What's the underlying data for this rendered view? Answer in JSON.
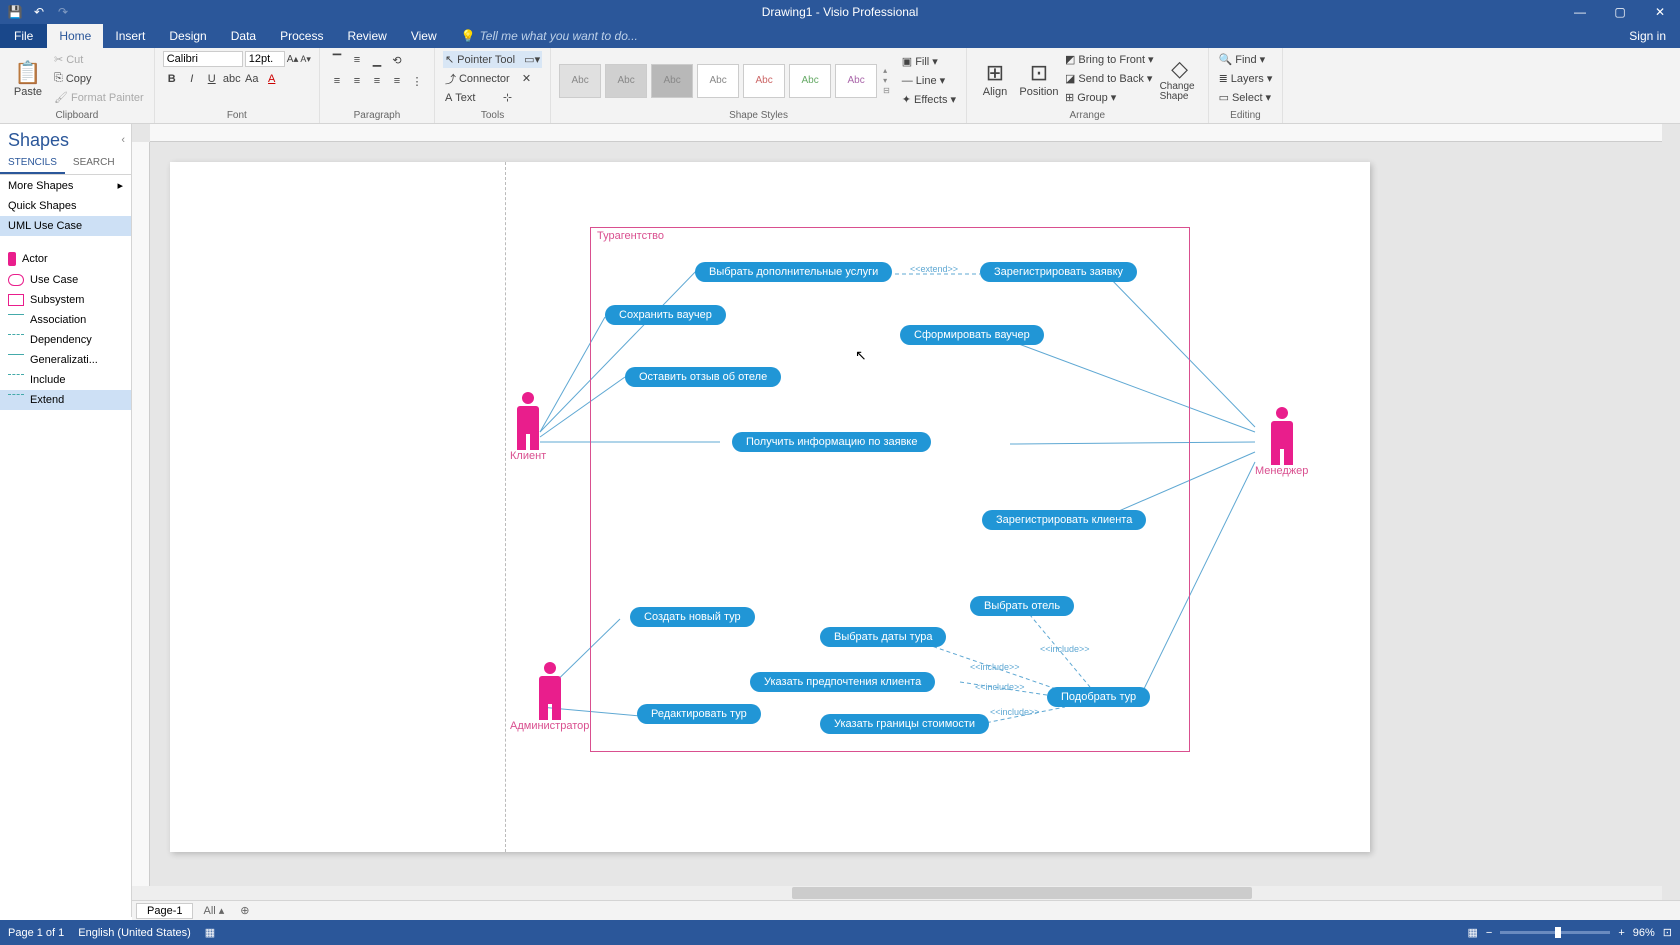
{
  "app": {
    "title": "Drawing1 - Visio Professional",
    "signin": "Sign in"
  },
  "qat": {
    "save": "💾",
    "undo": "↶",
    "redo": "↷"
  },
  "tabs": [
    "File",
    "Home",
    "Insert",
    "Design",
    "Data",
    "Process",
    "Review",
    "View"
  ],
  "activeTab": 1,
  "tellme": "Tell me what you want to do...",
  "ribbon": {
    "clipboard": {
      "paste": "Paste",
      "cut": "Cut",
      "copy": "Copy",
      "format_painter": "Format Painter",
      "label": "Clipboard"
    },
    "font": {
      "name": "Calibri",
      "size": "12pt.",
      "label": "Font"
    },
    "paragraph": {
      "label": "Paragraph"
    },
    "tools": {
      "pointer": "Pointer Tool",
      "connector": "Connector",
      "text": "Text",
      "label": "Tools"
    },
    "shapestyles": {
      "sample": "Abc",
      "fill": "Fill",
      "line": "Line",
      "effects": "Effects",
      "label": "Shape Styles"
    },
    "arrange": {
      "align": "Align",
      "position": "Position",
      "bring": "Bring to Front",
      "send": "Send to Back",
      "group": "Group",
      "change": "Change Shape",
      "label": "Arrange"
    },
    "editing": {
      "find": "Find",
      "layers": "Layers",
      "select": "Select",
      "label": "Editing"
    }
  },
  "shapes": {
    "title": "Shapes",
    "tabs": [
      "STENCILS",
      "SEARCH"
    ],
    "more": "More Shapes",
    "quick": "Quick Shapes",
    "stencil": "UML Use Case",
    "items": [
      "Actor",
      "Use Case",
      "Subsystem",
      "Association",
      "Dependency",
      "Generalizati...",
      "Include",
      "Extend"
    ]
  },
  "diagram": {
    "system": "Турагентство",
    "actors": {
      "client": "Клиент",
      "admin": "Администратор",
      "manager": "Менеджер"
    },
    "usecases": {
      "uc1": "Выбрать дополнительные услуги",
      "uc2": "Зарегистрировать заявку",
      "uc3": "Сохранить ваучер",
      "uc4": "Сформировать ваучер",
      "uc5": "Оставить отзыв об отеле",
      "uc6": "Получить информацию по заявке",
      "uc7": "Зарегистрировать клиента",
      "uc8": "Выбрать отель",
      "uc9": "Создать новый тур",
      "uc10": "Выбрать даты тура",
      "uc11": "Указать предпочтения клиента",
      "uc12": "Подобрать тур",
      "uc13": "Редактировать тур",
      "uc14": "Указать границы стоимости"
    },
    "stereotypes": {
      "extend": "<<extend>>",
      "include": "<<include>>"
    }
  },
  "pagetabs": {
    "page1": "Page-1",
    "all": "All"
  },
  "status": {
    "page": "Page 1 of 1",
    "lang": "English (United States)",
    "zoom": "96%"
  }
}
